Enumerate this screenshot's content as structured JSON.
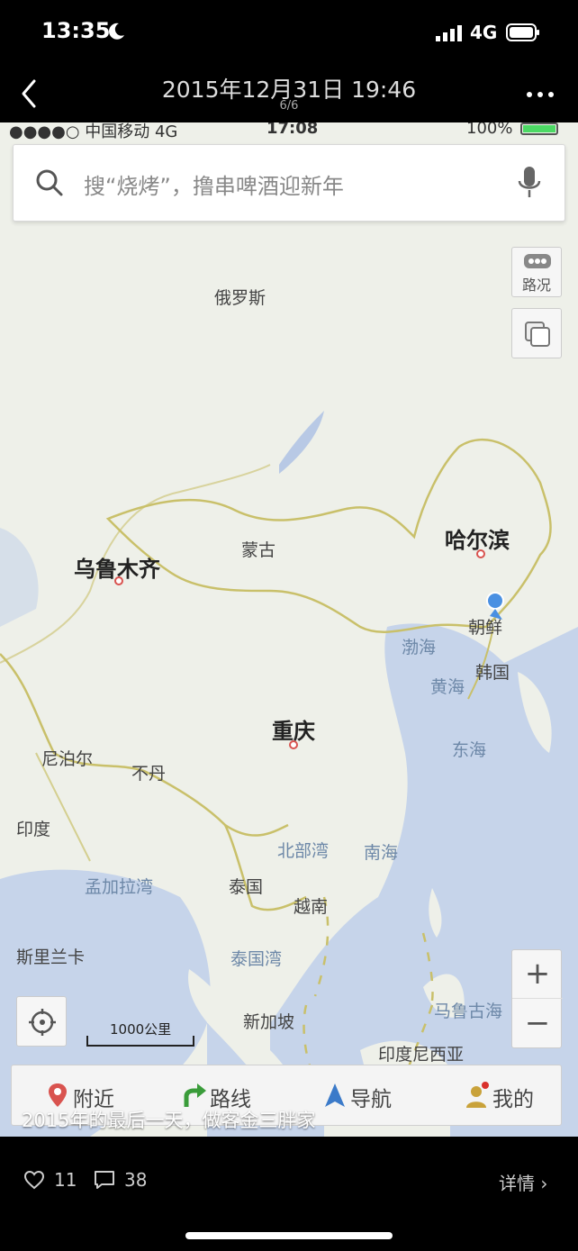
{
  "status_bar": {
    "time": "13:35",
    "network": "4G"
  },
  "top_bar": {
    "title": "2015年12月31日 19:46",
    "counter": "6/6"
  },
  "photo": {
    "phone_status": {
      "carrier": "●●●●○ 中国移动  4G",
      "time": "17:08",
      "battery": "100%"
    },
    "search": {
      "placeholder": "搜“烧烤”，撸串啤酒迎新年"
    },
    "map_controls": {
      "traffic": "路况",
      "zoom_in": "+",
      "zoom_out": "−",
      "scale": "1000公里"
    },
    "map_labels": {
      "russia": "俄罗斯",
      "mongolia": "蒙古",
      "harbin": "哈尔滨",
      "urumqi": "乌鲁木齐",
      "north_korea": "朝鲜",
      "bohai": "渤海",
      "south_korea": "韩国",
      "yellow_sea": "黄海",
      "chongqing": "重庆",
      "east_sea": "东海",
      "nepal": "尼泊尔",
      "bhutan": "不丹",
      "india": "印度",
      "beibu_gulf": "北部湾",
      "south_sea": "南海",
      "bay_of_bengal": "孟加拉湾",
      "thailand": "泰国",
      "vietnam": "越南",
      "sri_lanka": "斯里兰卡",
      "gulf_of_thailand": "泰国湾",
      "singapore": "新加坡",
      "maluku_sea": "马鲁古海",
      "indonesia": "印度尼西亚"
    },
    "bottom_nav": [
      {
        "label": "附近",
        "icon": "pin-icon"
      },
      {
        "label": "路线",
        "icon": "route-icon"
      },
      {
        "label": "导航",
        "icon": "navigation-icon"
      },
      {
        "label": "我的",
        "icon": "user-icon"
      }
    ],
    "caption": "2015年的最后一天，做客金三胖家"
  },
  "footer": {
    "likes": "11",
    "comments": "38",
    "detail": "详情"
  },
  "colors": {
    "land": "#eef0e9",
    "sea": "#c6d4ea",
    "border": "#c9c06a",
    "location_dot": "#4a90e2"
  }
}
